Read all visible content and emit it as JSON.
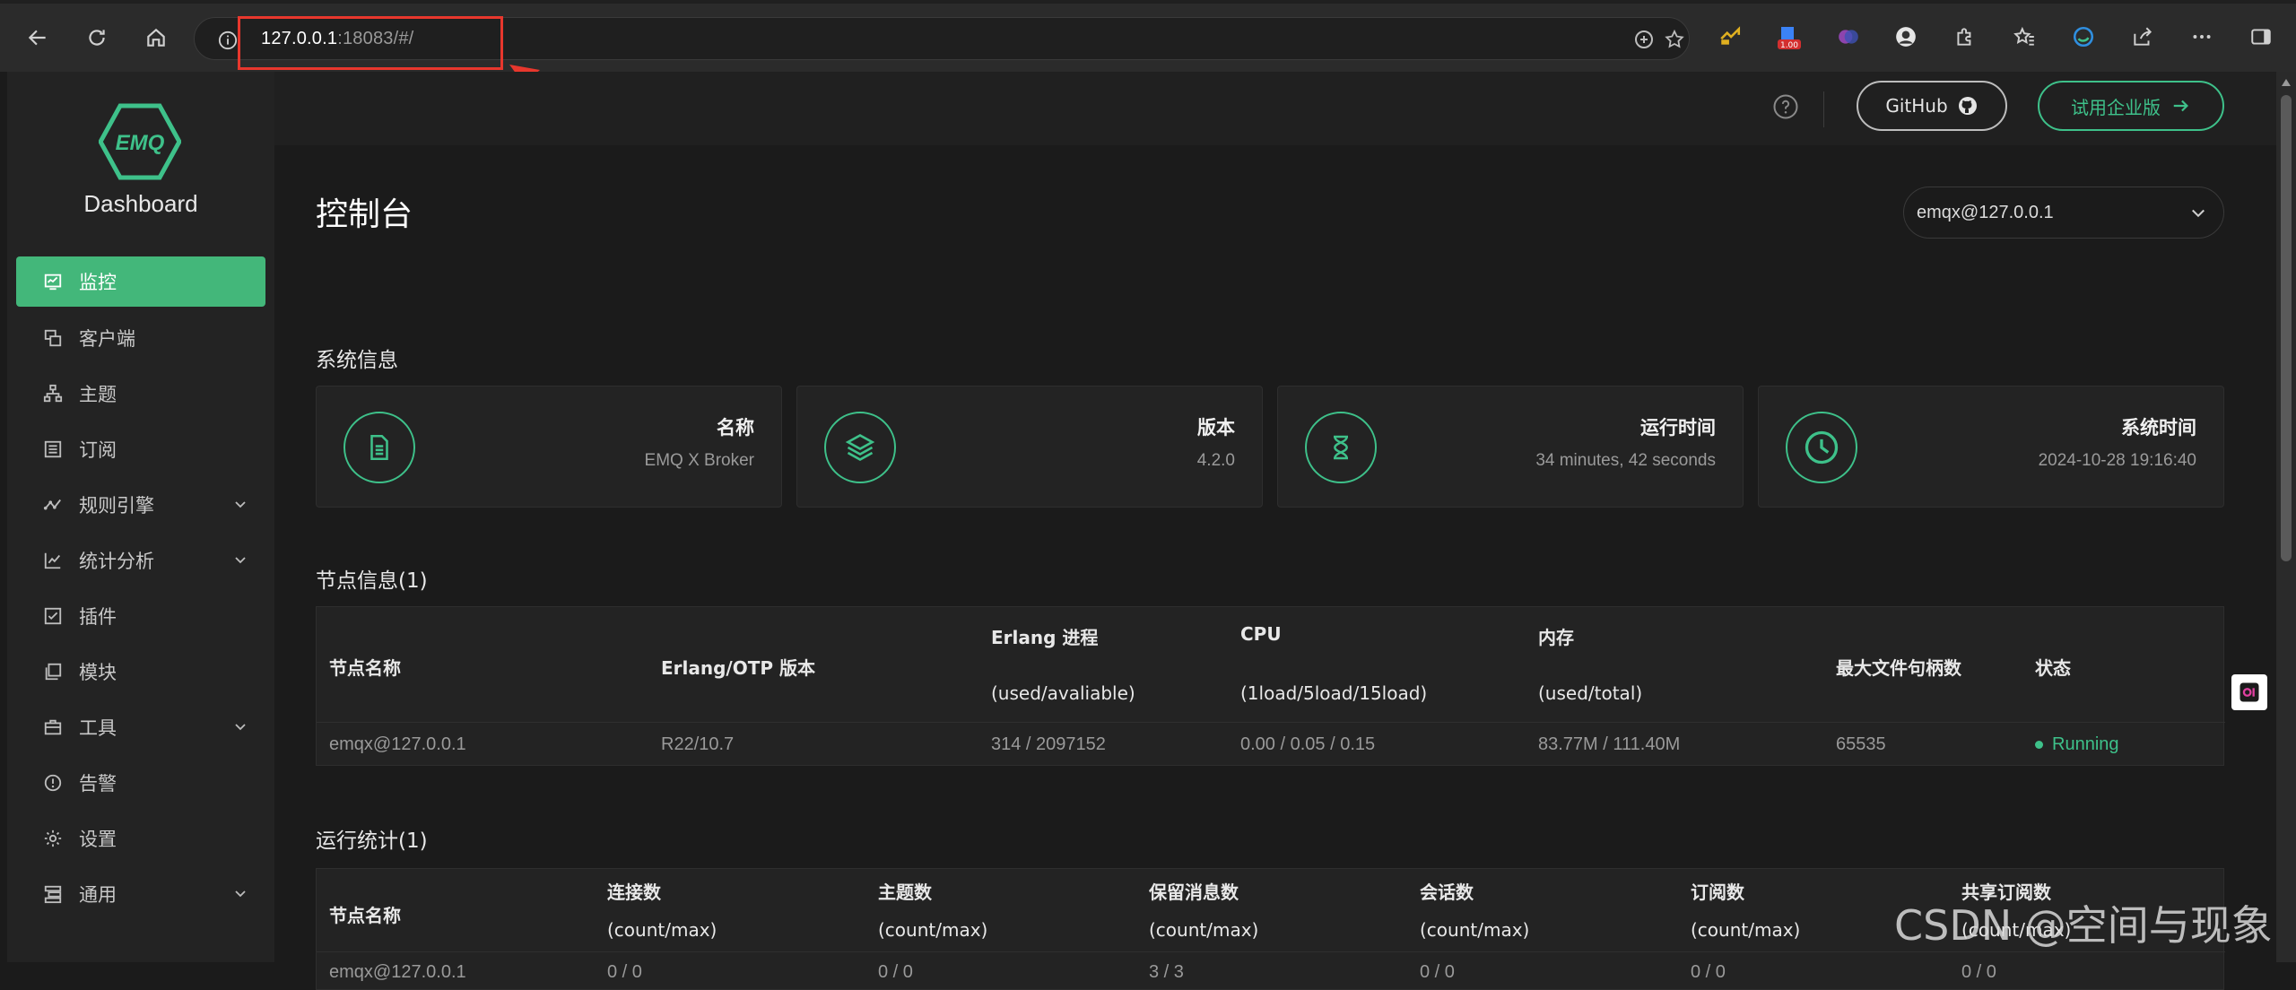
{
  "browser": {
    "url_host": "127.0.0.1",
    "url_rest": ":18083/#/",
    "ext_badge": "1.00"
  },
  "sidebar": {
    "logo_text": "EMQ",
    "brand": "Dashboard",
    "items": [
      {
        "label": "监控",
        "icon": "monitor-icon",
        "active": true
      },
      {
        "label": "客户端",
        "icon": "clients-icon"
      },
      {
        "label": "主题",
        "icon": "topics-icon"
      },
      {
        "label": "订阅",
        "icon": "subscriptions-icon"
      },
      {
        "label": "规则引擎",
        "icon": "rule-engine-icon",
        "expandable": true
      },
      {
        "label": "统计分析",
        "icon": "analytics-icon",
        "expandable": true
      },
      {
        "label": "插件",
        "icon": "plugins-icon"
      },
      {
        "label": "模块",
        "icon": "modules-icon"
      },
      {
        "label": "工具",
        "icon": "tools-icon",
        "expandable": true
      },
      {
        "label": "告警",
        "icon": "alarm-icon"
      },
      {
        "label": "设置",
        "icon": "settings-icon"
      },
      {
        "label": "通用",
        "icon": "general-icon",
        "expandable": true
      }
    ]
  },
  "topbar": {
    "github_label": "GitHub",
    "enterprise_label": "试用企业版"
  },
  "main": {
    "title": "控制台",
    "node_select_value": "emqx@127.0.0.1",
    "system_info_title": "系统信息",
    "cards": [
      {
        "label": "名称",
        "value": "EMQ X Broker",
        "icon": "document-icon"
      },
      {
        "label": "版本",
        "value": "4.2.0",
        "icon": "layers-icon"
      },
      {
        "label": "运行时间",
        "value": "34 minutes, 42 seconds",
        "icon": "hourglass-icon"
      },
      {
        "label": "系统时间",
        "value": "2024-10-28 19:16:40",
        "icon": "clock-icon"
      }
    ],
    "nodes_title": "节点信息(1)",
    "nodes_table": {
      "headers": [
        {
          "main": "节点名称",
          "sub": ""
        },
        {
          "main": "Erlang/OTP 版本",
          "sub": ""
        },
        {
          "main": "Erlang 进程",
          "sub": "(used/avaliable)"
        },
        {
          "main": "CPU",
          "sub": "(1load/5load/15load)"
        },
        {
          "main": "内存",
          "sub": "(used/total)"
        },
        {
          "main": "最大文件句柄数",
          "sub": ""
        },
        {
          "main": "状态",
          "sub": ""
        }
      ],
      "rows": [
        [
          "emqx@127.0.0.1",
          "R22/10.7",
          "314 / 2097152",
          "0.00 / 0.05 / 0.15",
          "83.77M / 111.40M",
          "65535",
          "Running"
        ]
      ]
    },
    "stats_title": "运行统计(1)",
    "stats_table": {
      "headers": [
        {
          "main": "节点名称",
          "sub": ""
        },
        {
          "main": "连接数",
          "sub": "(count/max)"
        },
        {
          "main": "主题数",
          "sub": "(count/max)"
        },
        {
          "main": "保留消息数",
          "sub": "(count/max)"
        },
        {
          "main": "会话数",
          "sub": "(count/max)"
        },
        {
          "main": "订阅数",
          "sub": "(count/max)"
        },
        {
          "main": "共享订阅数",
          "sub": "(count/max)"
        }
      ],
      "rows": [
        [
          "emqx@127.0.0.1",
          "0 / 0",
          "0 / 0",
          "3 / 3",
          "0 / 0",
          "0 / 0",
          "0 / 0"
        ]
      ]
    }
  },
  "watermark": "CSDN @空间与现象",
  "colors": {
    "accent": "#43b77a",
    "annotation": "#e8372d"
  }
}
